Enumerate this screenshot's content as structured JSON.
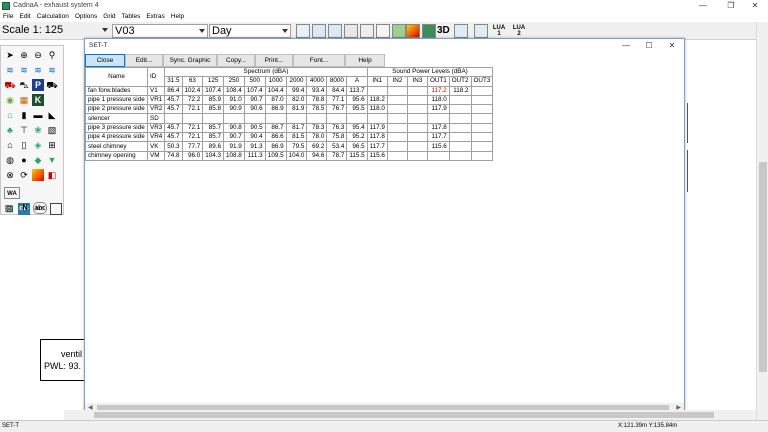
{
  "window": {
    "title": "CadnaA - exhaust system 4",
    "controls": [
      "—",
      "❐",
      "✕"
    ]
  },
  "menu": [
    "File",
    "Edit",
    "Calculation",
    "Options",
    "Grid",
    "Tables",
    "Extras",
    "Help"
  ],
  "toolbar": {
    "scale": "Scale 1: 125",
    "variant": "V03",
    "period": "Day",
    "label_3d": "3D",
    "lua1": "LUA\n1",
    "lua1_top": "LUA",
    "lua1_num": "1",
    "lua2_top": "LUA",
    "lua2_num": "2"
  },
  "palette": {
    "wa_label": "WA",
    "db_label": "dB",
    "abc_label": "abc",
    "k_label": "K",
    "p_label": "P",
    "n_label": "N",
    "km_label": "km"
  },
  "canvas": {
    "vent_line1": "ventil",
    "vent_line2": "PWL: 93."
  },
  "dialog": {
    "title": "SET-T",
    "buttons": [
      "Close",
      "Edit...",
      "Sync. Graphic",
      "Copy...",
      "Print...",
      "Font...",
      "Help"
    ],
    "header_group": {
      "name": "Name",
      "id": "ID",
      "spectrum": "Spectrum (dBA)",
      "swl": "Sound Power Levels (dBA)"
    },
    "columns": [
      "31.5",
      "63",
      "125",
      "250",
      "500",
      "1000",
      "2000",
      "4000",
      "8000",
      "A",
      "IN1",
      "IN2",
      "IN3",
      "OUT1",
      "OUT2",
      "OUT3"
    ],
    "rows": [
      {
        "name": "fan forw.blades",
        "id": "V1",
        "vals": [
          "86.4",
          "102.4",
          "107.4",
          "108.4",
          "107.4",
          "104.4",
          "99.4",
          "93.4",
          "84.4",
          "113.7",
          "",
          "",
          "",
          "117.2",
          "118.2",
          ""
        ]
      },
      {
        "name": "pipe 1 pressure side",
        "id": "VR1",
        "vals": [
          "45.7",
          "72.2",
          "85.9",
          "91.0",
          "90.7",
          "87.0",
          "82.0",
          "78.8",
          "77.1",
          "95.6",
          "118.2",
          "",
          "",
          "118.0",
          "",
          ""
        ]
      },
      {
        "name": "pipe 2 pressure side",
        "id": "VR2",
        "vals": [
          "45.7",
          "72.1",
          "85.8",
          "90.9",
          "90.6",
          "86.9",
          "81.9",
          "78.5",
          "76.7",
          "95.5",
          "118.0",
          "",
          "",
          "117.9",
          "",
          ""
        ]
      },
      {
        "name": "silencer",
        "id": "SD",
        "vals": [
          "",
          "",
          "",
          "",
          "",
          "",
          "",
          "",
          "",
          "",
          "",
          "",
          "",
          "",
          "",
          ""
        ]
      },
      {
        "name": "pipe 3 pressure side",
        "id": "VR3",
        "vals": [
          "45.7",
          "72.1",
          "85.7",
          "90.8",
          "90.5",
          "86.7",
          "81.7",
          "78.3",
          "76.3",
          "95.4",
          "117.9",
          "",
          "",
          "117.8",
          "",
          ""
        ]
      },
      {
        "name": "pipe 4 pressure side",
        "id": "VR4",
        "vals": [
          "45.7",
          "72.1",
          "85.7",
          "90.7",
          "90.4",
          "86.6",
          "81.5",
          "78.0",
          "75.8",
          "95.2",
          "117.8",
          "",
          "",
          "117.7",
          "",
          ""
        ]
      },
      {
        "name": "steel chimney",
        "id": "VK",
        "vals": [
          "50.3",
          "77.7",
          "89.6",
          "91.9",
          "91.3",
          "86.9",
          "79.5",
          "69.2",
          "53.4",
          "96.5",
          "117.7",
          "",
          "",
          "115.6",
          "",
          ""
        ]
      },
      {
        "name": "chimney opening",
        "id": "VM",
        "vals": [
          "74.8",
          "96.0",
          "104.3",
          "108.8",
          "111.3",
          "109.5",
          "104.0",
          "94.6",
          "78.7",
          "115.5",
          "115.6",
          "",
          "",
          "",
          "",
          ""
        ]
      }
    ],
    "highlight_color": "#d40000"
  },
  "statusbar": {
    "left": "SET-T",
    "coords": "X:121.39m Y:135.84m"
  }
}
